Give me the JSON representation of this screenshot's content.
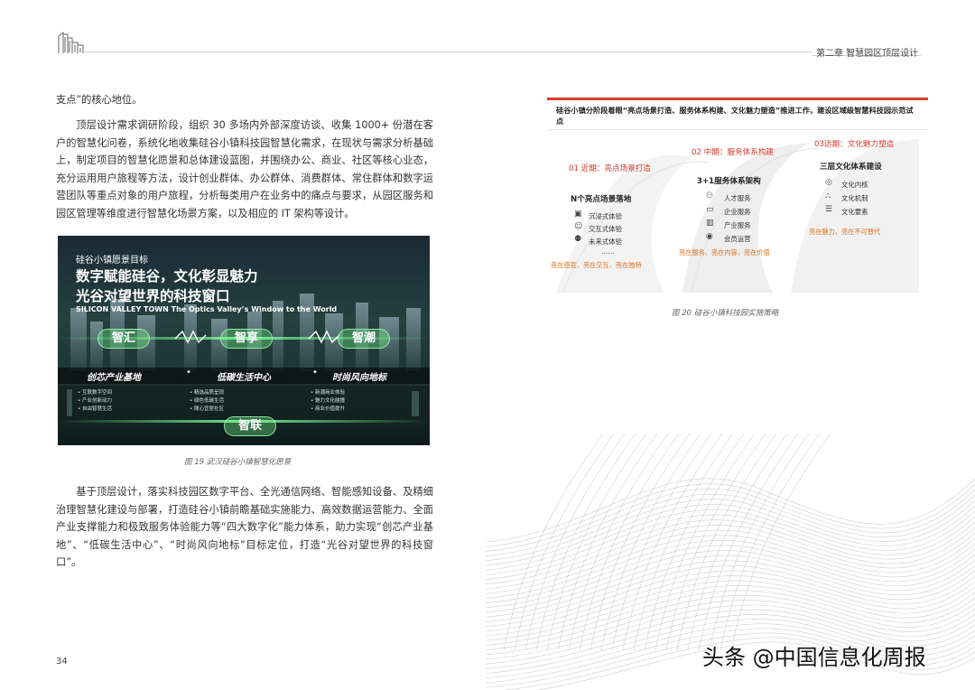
{
  "header": {
    "chapter_title": "第二章  智慧园区顶层设计"
  },
  "body": {
    "para0": "支点”的核心地位。",
    "para1": "顶层设计需求调研阶段，组织 30 多场内外部深度访谈、收集 1000+ 份潜在客户的智慧化问卷，系统化地收集硅谷小镇科技园智慧化需求，在现状与需求分析基础上，制定项目的智慧化愿景和总体建设蓝图，并围绕办公、商业、社区等核心业态，充分运用用户旅程等方法，设计创业群体、办公群体、消费群体、常住群体和数字运营团队等重点对象的用户旅程，分析每类用户在业务中的痛点与要求，从园区服务和园区管理等维度进行智慧化场景方案，以及相应的 IT 架构等设计。",
    "para2": "基于顶层设计，落实科技园区数字平台、全光通信网络、智能感知设备、及精细治理智慧化建设与部署，打造硅谷小镇前瞻基础实施能力、高效数据运营能力、全面产业支撑能力和极致服务体验能力等“四大数字化”能力体系，助力实现“创芯产业基地”、“低碳生活中心”、“时尚风向地标”目标定位，打造“光谷对望世界的科技窗口”。"
  },
  "figure19": {
    "subtitle": "硅谷小镇愿景目标",
    "title_line1": "数字赋能硅谷，文化彰显魅力",
    "title_line2": "光谷对望世界的科技窗口",
    "english": "SILICON VALLEY TOWN The Optics Valley’s Window to the World",
    "pills": [
      "智汇",
      "智享",
      "智潮"
    ],
    "bottom_pill": "智联",
    "bands": [
      "创芯产业基地",
      "低碳生活中心",
      "时尚风向地标"
    ],
    "band_dot": "•",
    "mini_cols": [
      [
        "• 互联数字空间",
        "• 产业创新动力",
        "• 自由智慧生活"
      ],
      [
        "• 精选品质呈现",
        "• 绿色低碳生活",
        "• 随心宜居社区"
      ],
      [
        "• 新潮商业体验",
        "• 魅力文化碰撞",
        "• 商业价值提升"
      ]
    ],
    "caption": "图 19  武汉硅谷小镇智慧化愿景"
  },
  "figure20": {
    "title": "硅谷小镇分阶段着眼“亮点场景打造、服务体系构建、文化魅力塑造”推进工作，建设区域级智慧科技园示范试点",
    "stages": [
      "01 近期：亮点场景打造",
      "02 中期：服务体系构建",
      "03远期：文化魅力塑造"
    ],
    "col1": {
      "heading": "N个亮点场景落地",
      "items": [
        "沉浸式体验",
        "交互式体验",
        "未来式体验",
        "……"
      ],
      "icons": [
        "▣",
        "☺",
        "⚉"
      ],
      "note": "亮在感官、亮在交互、亮在独特"
    },
    "col2": {
      "heading": "3+1服务体系架构",
      "items": [
        "人才服务",
        "企业服务",
        "产业服务",
        "会员运营"
      ],
      "icons": [
        "⚇",
        "▭",
        "▥",
        "◉"
      ],
      "note": "亮在服务、亮在内容、亮在价值"
    },
    "col3": {
      "heading": "三层文化体系建设",
      "items": [
        "文化内核",
        "文化机制",
        "文化要素"
      ],
      "icons": [
        "◎",
        "⛬",
        "☰"
      ],
      "note": "亮在魅力、亮在不可替代"
    },
    "caption": "图 20  硅谷小镇科技园实施策略"
  },
  "footer": {
    "page_number": "34",
    "watermark": "头条 @中国信息化周报"
  },
  "colors": {
    "accent_red": "#d8392c",
    "accent_orange": "#e0701c",
    "pill_green": "#78ff8c"
  }
}
